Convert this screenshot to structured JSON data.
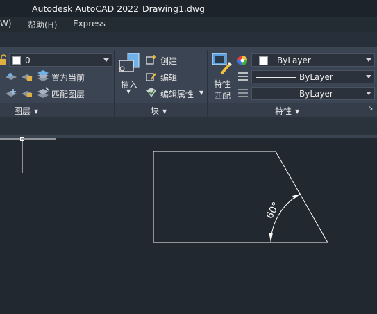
{
  "titlebar": {
    "app": "Autodesk AutoCAD 2022",
    "document": "Drawing1.dwg"
  },
  "menubar": {
    "items": [
      "W)",
      "帮助(H)",
      "Express"
    ]
  },
  "ribbon": {
    "layers": {
      "current_layer": "0",
      "set_current": "置为当前",
      "match_layer": "匹配图层",
      "title": "图层"
    },
    "block": {
      "insert": "插入",
      "create": "创建",
      "edit": "编辑",
      "edit_attributes": "编辑属性",
      "title": "块"
    },
    "properties": {
      "match_line1": "特性",
      "match_line2": "匹配",
      "color": "ByLayer",
      "linetype": "ByLayer",
      "lineweight": "ByLayer",
      "title": "特性"
    }
  },
  "drawing": {
    "angle_label": "60°"
  },
  "colors": {
    "background": "#212830",
    "ribbon": "#3b4452",
    "geometry": "#ffffff"
  }
}
